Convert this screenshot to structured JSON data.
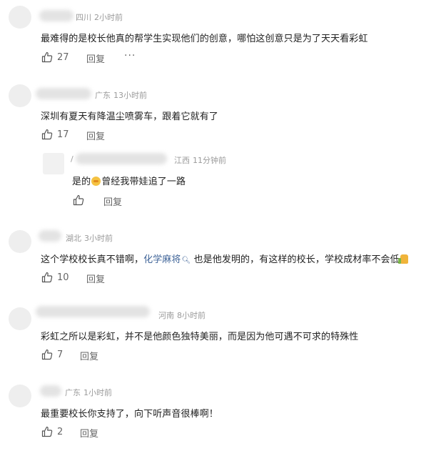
{
  "comments": [
    {
      "location": "四川",
      "time": "2小时前",
      "text": "最难得的是校长他真的帮学生实现他们的创意，哪怕这创意只是为了天天看彩虹",
      "likes": "27",
      "reply_label": "回复",
      "more_label": "···"
    },
    {
      "location": "广东",
      "time": "13小时前",
      "text": "深圳有夏天有降温尘喷雾车，跟着它就有了",
      "likes": "17",
      "reply_label": "回复",
      "replies": [
        {
          "prefix": "/",
          "location": "江西",
          "time": "11分钟前",
          "text_before": "是的",
          "emoji": "smile-emoji",
          "text_after": "曾经我带娃追了一路",
          "reply_label": "回复"
        }
      ]
    },
    {
      "location": "湖北",
      "time": "3小时前",
      "text_before": "这个学校校长真不错啊，",
      "link_text": "化学麻将",
      "text_after": "也是他发明的，有这样的校长，学校成材率不会低",
      "emoji": "thumbs-up-emoji",
      "likes": "10",
      "reply_label": "回复"
    },
    {
      "location": "河南",
      "time": "8小时前",
      "text": "彩虹之所以是彩虹，并不是他颜色独特美丽，而是因为他可遇不可求的特殊性",
      "likes": "7",
      "reply_label": "回复"
    },
    {
      "location": "广东",
      "time": "1小时前",
      "text": "最重要校长你支持了，向下听声音很棒啊！",
      "likes": "2",
      "reply_label": "回复"
    }
  ]
}
